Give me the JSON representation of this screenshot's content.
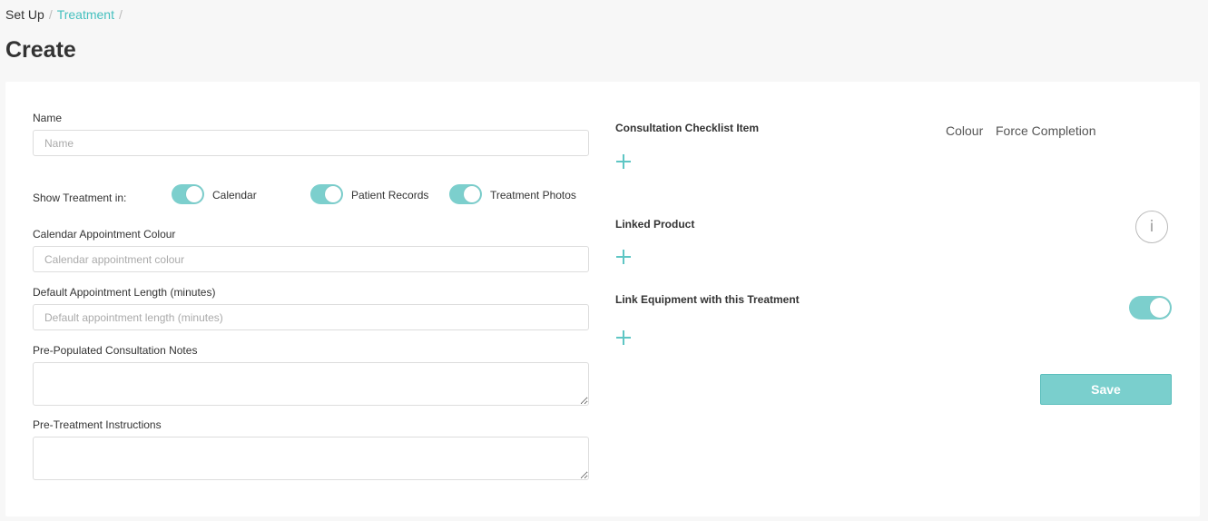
{
  "breadcrumb": {
    "items": [
      "Set Up",
      "Treatment"
    ],
    "separator": "/"
  },
  "page": {
    "title": "Create"
  },
  "form": {
    "name": {
      "label": "Name",
      "placeholder": "Name",
      "value": ""
    },
    "show_treatment": {
      "label": "Show Treatment in:",
      "options": [
        {
          "label": "Calendar",
          "on": true
        },
        {
          "label": "Patient Records",
          "on": true
        },
        {
          "label": "Treatment Photos",
          "on": true
        }
      ]
    },
    "calendar_colour": {
      "label": "Calendar Appointment Colour",
      "placeholder": "Calendar appointment colour",
      "value": ""
    },
    "default_length": {
      "label": "Default Appointment Length (minutes)",
      "placeholder": "Default appointment length (minutes)",
      "value": ""
    },
    "consultation_notes": {
      "label": "Pre-Populated Consultation Notes",
      "value": ""
    },
    "pre_treatment": {
      "label": "Pre-Treatment Instructions",
      "value": ""
    }
  },
  "right": {
    "checklist": {
      "title": "Consultation Checklist Item",
      "col_colour": "Colour",
      "col_force": "Force Completion",
      "add_icon": "plus-icon"
    },
    "linked_product": {
      "title": "Linked Product",
      "info_icon": "info-icon",
      "info_glyph": "i"
    },
    "link_equipment": {
      "title": "Link Equipment with this Treatment",
      "toggle_on": true
    },
    "save_label": "Save"
  },
  "colors": {
    "accent": "#45c0bf",
    "toggle": "#7ccfcd",
    "save_button": "#7acfcd"
  }
}
